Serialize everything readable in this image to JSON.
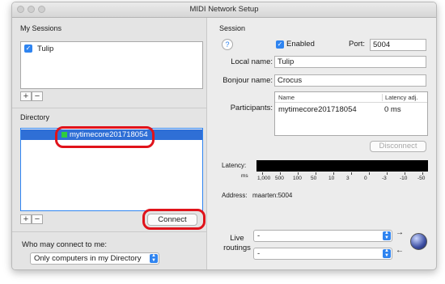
{
  "window": {
    "title": "MIDI Network Setup"
  },
  "my_sessions": {
    "heading": "My Sessions",
    "items": [
      {
        "label": "Tulip",
        "checked": true
      }
    ],
    "add_label": "+",
    "remove_label": "−"
  },
  "directory": {
    "heading": "Directory",
    "items": [
      {
        "label": "mytimecore201718054",
        "selected": true,
        "status_color": "#2ecc40"
      }
    ],
    "add_label": "+",
    "remove_label": "−",
    "connect_label": "Connect"
  },
  "access": {
    "label": "Who may connect to me:",
    "selected": "Only computers in my Directory"
  },
  "session": {
    "heading": "Session",
    "help_label": "?",
    "enabled_label": "Enabled",
    "enabled": true,
    "port_label": "Port:",
    "port_value": "5004",
    "local_name_label": "Local name:",
    "local_name_value": "Tulip",
    "bonjour_name_label": "Bonjour name:",
    "bonjour_name_value": "Crocus",
    "participants_label": "Participants:",
    "participants_columns": [
      "Name",
      "Latency adj."
    ],
    "participants_rows": [
      {
        "name": "mytimecore201718054",
        "latency": "0 ms"
      }
    ],
    "disconnect_label": "Disconnect",
    "latency_label": "Latency:",
    "latency_unit": "ms",
    "latency_ticks": [
      "1,000",
      "500",
      "100",
      "50",
      "10",
      "3",
      "0",
      "-3",
      "-10",
      "-50"
    ],
    "address_label": "Address:",
    "address_value": "maarten:5004"
  },
  "live_routings": {
    "label_line1": "Live",
    "label_line2": "routings",
    "input_value": "-",
    "output_value": "-"
  },
  "colors": {
    "selection": "#2f6fd6",
    "accent": "#2f84f0",
    "annotation_red": "#e0131b"
  }
}
